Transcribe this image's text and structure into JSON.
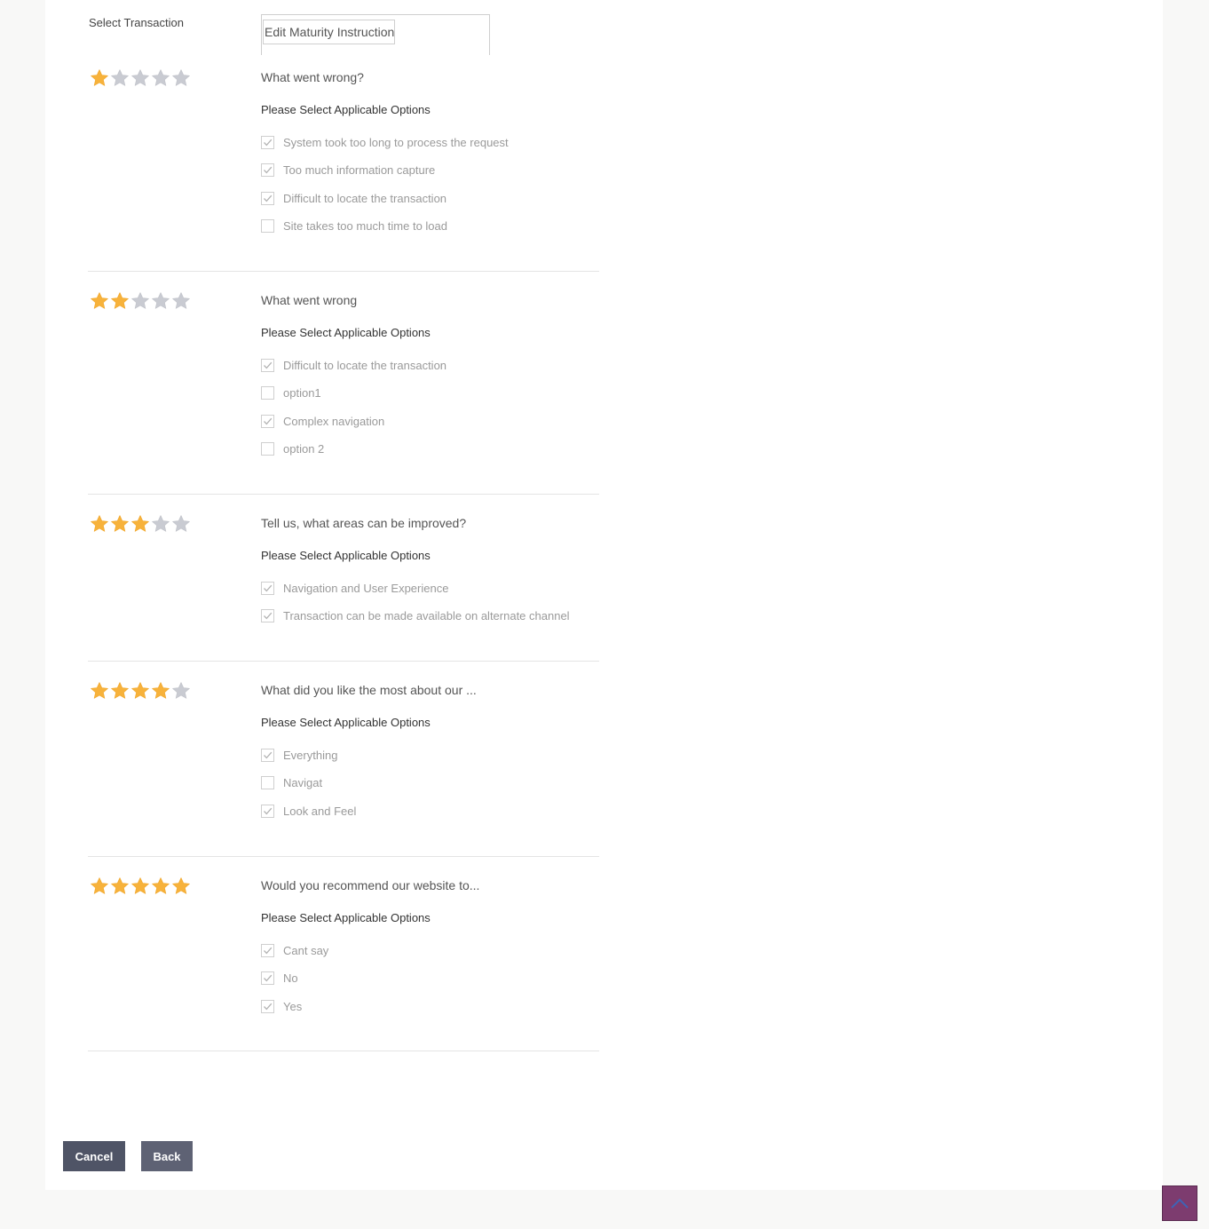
{
  "transaction": {
    "label": "Select Transaction",
    "selected": "Edit Maturity Instruction"
  },
  "colors": {
    "star_filled": "#f7b23b",
    "star_empty": "#c9cbd2",
    "cancel_button": "#4f5466",
    "back_button": "#5e6274",
    "scroll_top_button": "#7d3c6f"
  },
  "sections": [
    {
      "rating": 1,
      "question": "What went wrong?",
      "subtitle": "Please Select Applicable Options",
      "options": [
        {
          "label": "System took too long to process the request",
          "checked": true
        },
        {
          "label": "Too much information capture",
          "checked": true
        },
        {
          "label": "Difficult to locate the transaction",
          "checked": true
        },
        {
          "label": "Site takes too much time to load",
          "checked": false
        }
      ]
    },
    {
      "rating": 2,
      "question": "What went wrong",
      "subtitle": "Please Select Applicable Options",
      "options": [
        {
          "label": "Difficult to locate the transaction",
          "checked": true
        },
        {
          "label": "option1",
          "checked": false
        },
        {
          "label": "Complex navigation",
          "checked": true
        },
        {
          "label": "option 2",
          "checked": false
        }
      ]
    },
    {
      "rating": 3,
      "question": "Tell us, what areas can be improved?",
      "subtitle": "Please Select Applicable Options",
      "options": [
        {
          "label": "Navigation and User Experience",
          "checked": true
        },
        {
          "label": "Transaction can be made available on alternate channel",
          "checked": true
        }
      ]
    },
    {
      "rating": 4,
      "question": "What did you like the most about our ...",
      "subtitle": "Please Select Applicable Options",
      "options": [
        {
          "label": "Everything",
          "checked": true
        },
        {
          "label": "Navigat",
          "checked": false
        },
        {
          "label": "Look and Feel",
          "checked": true
        }
      ]
    },
    {
      "rating": 5,
      "question": "Would you recommend our website to...",
      "subtitle": "Please Select Applicable Options",
      "options": [
        {
          "label": "Cant say",
          "checked": true
        },
        {
          "label": "No",
          "checked": true
        },
        {
          "label": "Yes",
          "checked": true
        }
      ]
    }
  ],
  "buttons": {
    "cancel": "Cancel",
    "back": "Back"
  },
  "scroll_top_icon": "chevron-up-icon"
}
